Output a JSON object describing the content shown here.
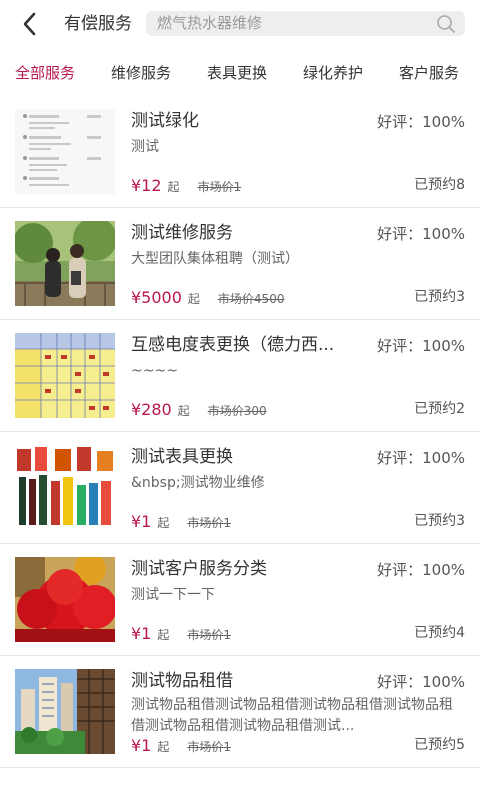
{
  "header": {
    "title": "有偿服务",
    "search_placeholder": "燃气热水器维修"
  },
  "tabs": [
    {
      "label": "全部服务",
      "active": true
    },
    {
      "label": "维修服务",
      "active": false
    },
    {
      "label": "表具更换",
      "active": false
    },
    {
      "label": "绿化养护",
      "active": false
    },
    {
      "label": "客户服务",
      "active": false
    }
  ],
  "colors": {
    "accent": "#b8174f",
    "text": "#333333",
    "muted": "#666666"
  },
  "items": [
    {
      "title": "测试绿化",
      "rating": "好评：100%",
      "desc": "测试",
      "price": "¥12",
      "unit": "起",
      "market_price": "市场价1",
      "booked": "已预约8",
      "thumb_icon": "document-screenshot-thumbnail"
    },
    {
      "title": "测试维修服务",
      "rating": "好评：100%",
      "desc": "大型团队集体租聘（测试）",
      "price": "¥5000",
      "unit": "起",
      "market_price": "市场价4500",
      "booked": "已预约3",
      "thumb_icon": "people-outdoor-photo"
    },
    {
      "title": "互感电度表更换（德力西...",
      "rating": "好评：100%",
      "desc": "~~~~",
      "price": "¥280",
      "unit": "起",
      "market_price": "市场价300",
      "booked": "已预约2",
      "thumb_icon": "table-chart-thumbnail"
    },
    {
      "title": "测试表具更换",
      "rating": "好评：100%",
      "desc": "&nbsp;测试物业维修",
      "price": "¥1",
      "unit": "起",
      "market_price": "市场价1",
      "booked": "已预约3",
      "thumb_icon": "bottles-photo"
    },
    {
      "title": "测试客户服务分类",
      "rating": "好评：100%",
      "desc": "测试一下一下",
      "price": "¥1",
      "unit": "起",
      "market_price": "市场价1",
      "booked": "已预约4",
      "thumb_icon": "red-tree-photo"
    },
    {
      "title": "测试物品租借",
      "rating": "好评：100%",
      "desc": "测试物品租借测试物品租借测试物品租借测试物品租借测试物品租借测试物品租借测试...",
      "price": "¥1",
      "unit": "起",
      "market_price": "市场价1",
      "booked": "已预约5",
      "thumb_icon": "buildings-photo"
    }
  ]
}
